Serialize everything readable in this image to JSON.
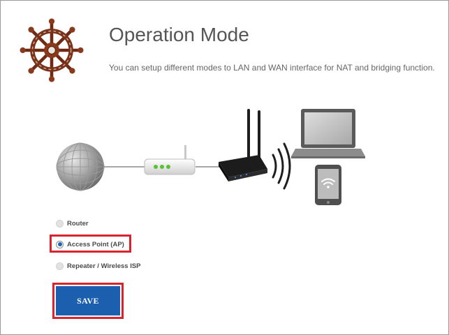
{
  "header": {
    "title": "Operation Mode",
    "description": "You can setup different modes to LAN and WAN interface for NAT and bridging function."
  },
  "modes": {
    "options": [
      {
        "label": "Router",
        "selected": false
      },
      {
        "label": "Access Point (AP)",
        "selected": true
      },
      {
        "label": "Repeater / Wireless ISP",
        "selected": false
      }
    ]
  },
  "actions": {
    "save_label": "SAVE"
  },
  "colors": {
    "accent": "#1b5fae",
    "highlight": "#d9232e",
    "title": "#555555"
  },
  "icons": [
    "ship-wheel-icon",
    "globe-icon",
    "modem-icon",
    "router-icon",
    "wifi-signal-icon",
    "laptop-icon",
    "tablet-icon"
  ]
}
